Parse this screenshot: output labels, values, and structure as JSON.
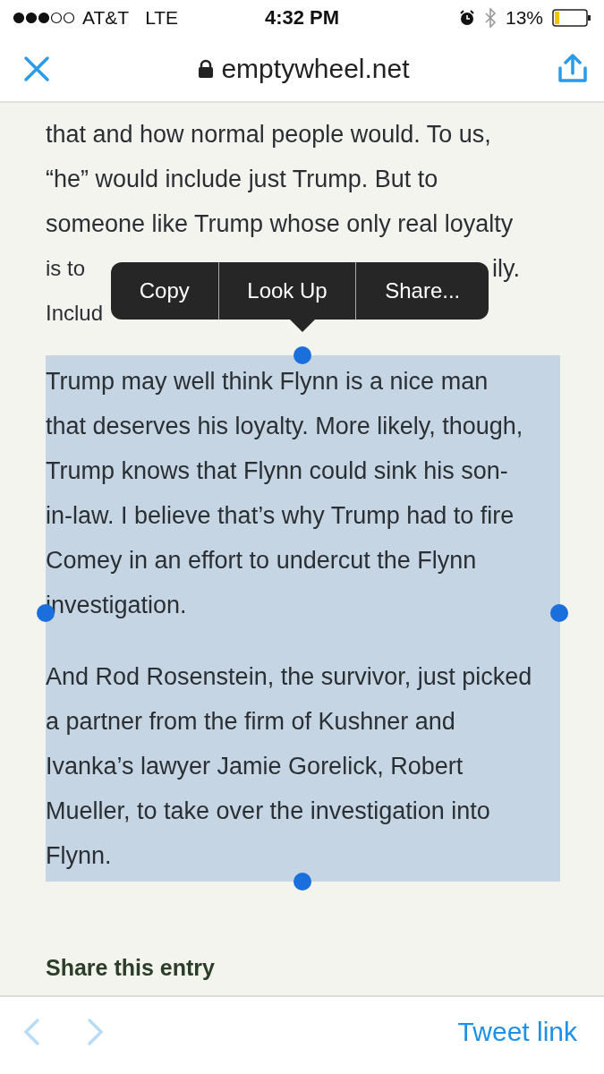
{
  "status_bar": {
    "carrier": "AT&T",
    "network": "LTE",
    "time": "4:32 PM",
    "battery": "13%"
  },
  "nav_bar": {
    "url": "emptywheel.net"
  },
  "article": {
    "lead_lines": [
      "that and how normal people would. To us,",
      "“he” would include just Trump. But to",
      "someone like Trump whose only real loyalty"
    ],
    "covered_lines": [
      {
        "left": "is to",
        "right": "ily."
      },
      {
        "left": "Includ"
      }
    ],
    "paragraphs": [
      {
        "selected": true,
        "lines": [
          "Trump may well think Flynn is a nice man",
          "that deserves his loyalty. More likely, though,",
          "Trump knows that Flynn could sink his son-",
          "in-law. I believe that’s why Trump had to fire",
          "Comey in an effort to undercut the Flynn",
          "investigation."
        ]
      },
      {
        "selected": true,
        "lines": [
          "And Rod Rosenstein, the survivor, just picked",
          "a partner from the firm of Kushner and",
          "Ivanka’s lawyer Jamie Gorelick, Robert",
          "Mueller, to take over the investigation into",
          "Flynn."
        ]
      }
    ],
    "share_heading": "Share this entry"
  },
  "context_menu": {
    "items": [
      "Copy",
      "Look Up",
      "Share..."
    ]
  },
  "toolbar": {
    "back": {
      "disabled": true
    },
    "forward": {
      "disabled": true
    },
    "tweet_link": "Tweet link"
  }
}
